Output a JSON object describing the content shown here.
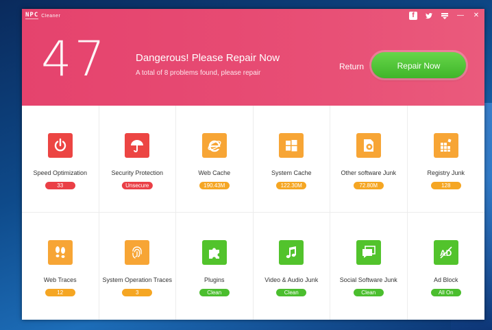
{
  "app": {
    "logo_mark": "NPC",
    "logo_name": "Cleaner"
  },
  "title_bar": {
    "icons": [
      "facebook-icon",
      "twitter-icon",
      "menu-icon",
      "minimize-icon",
      "close-icon"
    ],
    "facebook": "f",
    "twitter": "🐦",
    "menu": "☰",
    "minimize": "—",
    "close": "✕"
  },
  "header": {
    "score": "47",
    "title": "Dangerous! Please Repair Now",
    "subtitle": "A total of 8 problems found, please repair",
    "return_label": "Return",
    "repair_label": "Repair Now",
    "background_color": "#e5436d",
    "repair_color": "#4fc435"
  },
  "items": [
    {
      "label": "Speed Optimization",
      "badge": "33",
      "status": "red",
      "icon": "power-icon"
    },
    {
      "label": "Security Protection",
      "badge": "Unsecure",
      "status": "red",
      "icon": "umbrella-icon"
    },
    {
      "label": "Web Cache",
      "badge": "190.43M",
      "status": "orange",
      "icon": "ie-icon"
    },
    {
      "label": "System Cache",
      "badge": "122.30M",
      "status": "orange",
      "icon": "windows-icon"
    },
    {
      "label": "Other software Junk",
      "badge": "72.80M",
      "status": "orange",
      "icon": "software-icon"
    },
    {
      "label": "Registry Junk",
      "badge": "128",
      "status": "orange",
      "icon": "registry-icon"
    },
    {
      "label": "Web Traces",
      "badge": "12",
      "status": "orange",
      "icon": "footprints-icon"
    },
    {
      "label": "System Operation Traces",
      "badge": "3",
      "status": "orange",
      "icon": "fingerprint-icon"
    },
    {
      "label": "Plugins",
      "badge": "Clean",
      "status": "green",
      "icon": "puzzle-icon"
    },
    {
      "label": "Video & Audio Junk",
      "badge": "Clean",
      "status": "green",
      "icon": "music-icon"
    },
    {
      "label": "Social Software Junk",
      "badge": "Clean",
      "status": "green",
      "icon": "chat-icon"
    },
    {
      "label": "Ad Block",
      "badge": "All On",
      "status": "green",
      "icon": "ad-block-icon"
    }
  ]
}
